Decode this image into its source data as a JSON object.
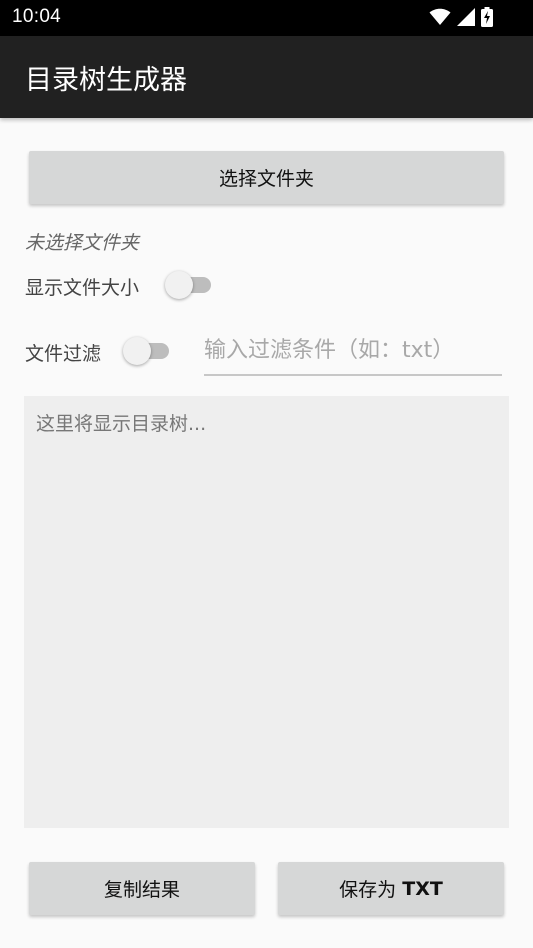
{
  "status_bar": {
    "time": "10:04",
    "icons": [
      "wifi-icon",
      "cell-signal-icon",
      "battery-charging-icon"
    ]
  },
  "app_bar": {
    "title": "目录树生成器",
    "background": "#212121"
  },
  "select_folder_button": {
    "label": "选择文件夹"
  },
  "folder_status": "未选择文件夹",
  "show_size": {
    "label": "显示文件大小",
    "enabled": false
  },
  "file_filter": {
    "label": "文件过滤",
    "enabled": false,
    "placeholder": "输入过滤条件（如：txt）",
    "value": ""
  },
  "tree_output": {
    "placeholder": "这里将显示目录树..."
  },
  "actions": {
    "copy_label": "复制结果",
    "save_prefix": "保存为",
    "save_format": "TXT"
  },
  "colors": {
    "button_bg": "#d6d7d7",
    "page_bg": "#fafafa",
    "tree_bg": "#eeeeee"
  }
}
